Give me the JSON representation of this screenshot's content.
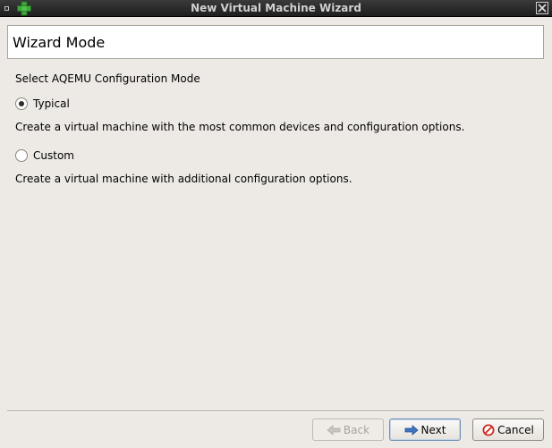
{
  "window": {
    "title": "New Virtual Machine Wizard"
  },
  "header": {
    "title": "Wizard Mode"
  },
  "content": {
    "mode_label": "Select AQEMU Configuration Mode",
    "options": [
      {
        "label": "Typical",
        "selected": true,
        "description": "Create a virtual machine with the most common devices and configuration options."
      },
      {
        "label": "Custom",
        "selected": false,
        "description": "Create a virtual machine with additional configuration options."
      }
    ]
  },
  "buttons": {
    "back": {
      "label": "Back",
      "enabled": false,
      "icon": "arrow-left-icon"
    },
    "next": {
      "label": "Next",
      "enabled": true,
      "icon": "arrow-right-icon"
    },
    "cancel": {
      "label": "Cancel",
      "enabled": true,
      "icon": "cancel-icon"
    }
  },
  "colors": {
    "titlebar": "#1e1e1e",
    "window_bg": "#edeae5",
    "arrow_blue": "#2f5fa8",
    "cancel_red": "#cc2a1e",
    "app_icon_green": "#3fa63c"
  }
}
